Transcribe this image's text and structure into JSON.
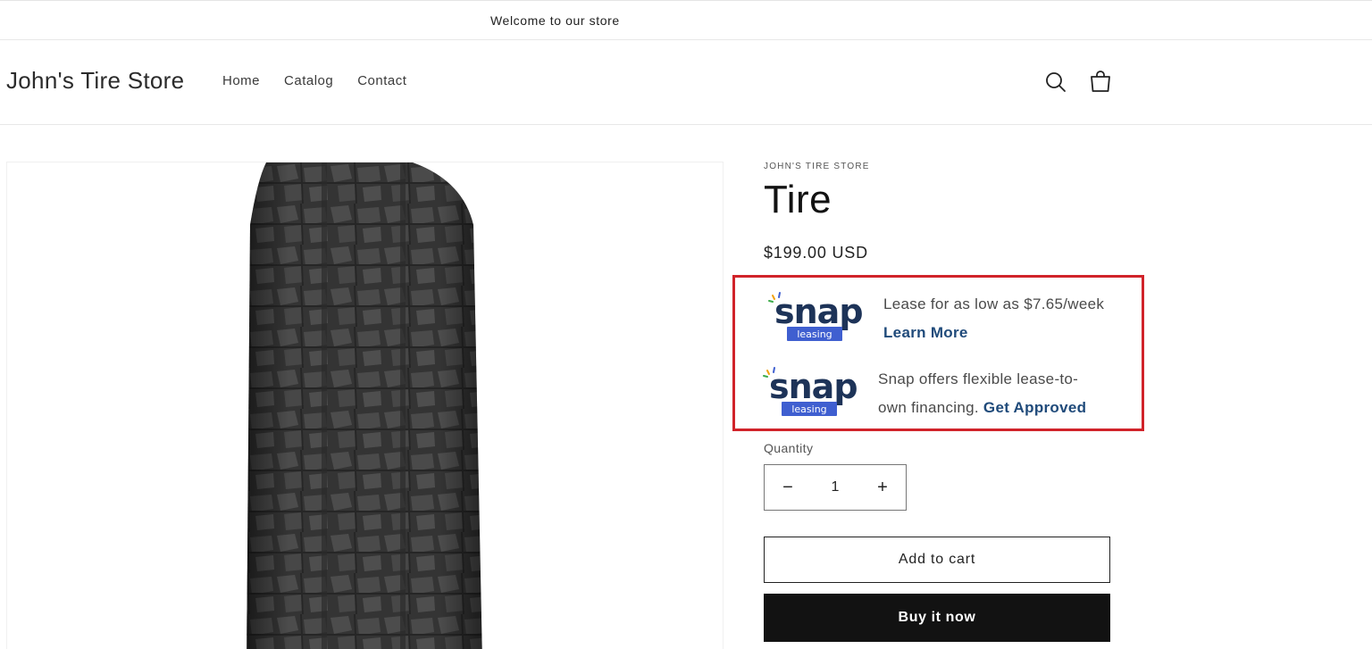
{
  "announcement": {
    "text": "Welcome to our store"
  },
  "header": {
    "logo": "John's Tire Store",
    "nav": [
      "Home",
      "Catalog",
      "Contact"
    ],
    "icons": [
      "search-icon",
      "cart-icon"
    ]
  },
  "product": {
    "vendor": "JOHN'S TIRE STORE",
    "title": "Tire",
    "price": "$199.00 USD",
    "image": "tire-product-image"
  },
  "snap": {
    "brand": "snap",
    "sub": "leasing",
    "row1_text": "Lease for as low as $7.65/week",
    "row1_link": "Learn More",
    "row2_text": "Snap offers flexible lease-to-own financing.",
    "row2_link": "Get Approved",
    "colors": {
      "navy": "#1d3358",
      "badge": "#3f5fd0",
      "highlight": "#d1232a"
    }
  },
  "quantity": {
    "label": "Quantity",
    "value": "1",
    "minus": "−",
    "plus": "+"
  },
  "buttons": {
    "add_to_cart": "Add to cart",
    "buy_now": "Buy it now"
  }
}
